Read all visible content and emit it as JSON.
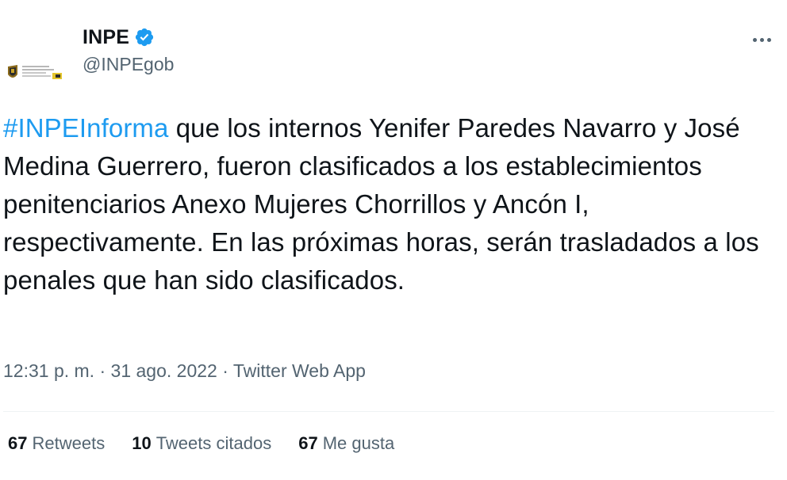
{
  "account": {
    "display_name": "INPE",
    "handle": "@INPEgob",
    "verified": true,
    "verified_icon": "verified-badge-icon",
    "avatar_icon": "inpe-logo-icon"
  },
  "tweet": {
    "hashtag": "#INPEInforma",
    "text": " que los internos Yenifer Paredes Navarro y José Medina Guerrero, fueron clasificados a los establecimientos penitenciarios Anexo Mujeres Chorrillos y Ancón I, respectivamente. En las próximas horas, serán trasladados a los penales que han sido clasificados.",
    "time": "12:31 p. m.",
    "separator": "·",
    "date": "31 ago. 2022",
    "source": "Twitter Web App"
  },
  "stats": {
    "retweets_count": "67",
    "retweets_label": "Retweets",
    "quotes_count": "10",
    "quotes_label": "Tweets citados",
    "likes_count": "67",
    "likes_label": "Me gusta"
  },
  "colors": {
    "accent": "#1d9bf0",
    "text": "#0f1419",
    "secondary": "#536471"
  },
  "menu_icon": "more-options-icon"
}
